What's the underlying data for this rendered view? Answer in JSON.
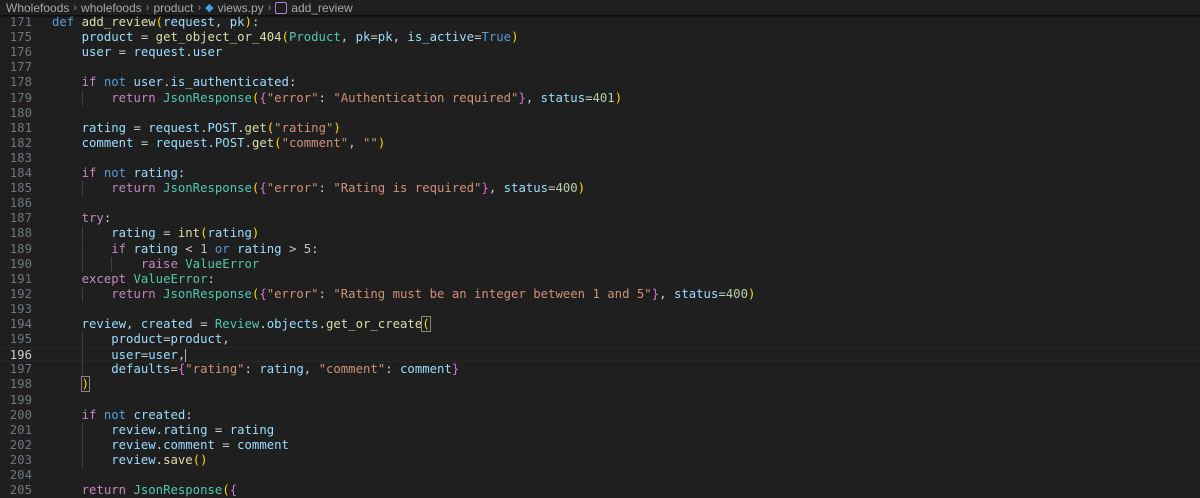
{
  "breadcrumb": {
    "items": [
      "Wholefoods",
      "wholefoods",
      "product",
      "views.py",
      "add_review"
    ]
  },
  "editor": {
    "language": "python",
    "active_line": 196,
    "lines": [
      {
        "num": "171",
        "text": "def add_review(request, pk):"
      },
      {
        "num": "175",
        "text": "    product = get_object_or_404(Product, pk=pk, is_active=True)"
      },
      {
        "num": "176",
        "text": "    user = request.user"
      },
      {
        "num": "177",
        "text": ""
      },
      {
        "num": "178",
        "text": "    if not user.is_authenticated:"
      },
      {
        "num": "179",
        "text": "        return JsonResponse({\"error\": \"Authentication required\"}, status=401)"
      },
      {
        "num": "180",
        "text": ""
      },
      {
        "num": "181",
        "text": "    rating = request.POST.get(\"rating\")"
      },
      {
        "num": "182",
        "text": "    comment = request.POST.get(\"comment\", \"\")"
      },
      {
        "num": "183",
        "text": ""
      },
      {
        "num": "184",
        "text": "    if not rating:"
      },
      {
        "num": "185",
        "text": "        return JsonResponse({\"error\": \"Rating is required\"}, status=400)"
      },
      {
        "num": "186",
        "text": ""
      },
      {
        "num": "187",
        "text": "    try:"
      },
      {
        "num": "188",
        "text": "        rating = int(rating)"
      },
      {
        "num": "189",
        "text": "        if rating < 1 or rating > 5:"
      },
      {
        "num": "190",
        "text": "            raise ValueError"
      },
      {
        "num": "191",
        "text": "    except ValueError:"
      },
      {
        "num": "192",
        "text": "        return JsonResponse({\"error\": \"Rating must be an integer between 1 and 5\"}, status=400)"
      },
      {
        "num": "193",
        "text": ""
      },
      {
        "num": "194",
        "text": "    review, created = Review.objects.get_or_create("
      },
      {
        "num": "195",
        "text": "        product=product,"
      },
      {
        "num": "196",
        "text": "        user=user,"
      },
      {
        "num": "197",
        "text": "        defaults={\"rating\": rating, \"comment\": comment}"
      },
      {
        "num": "198",
        "text": "    )"
      },
      {
        "num": "199",
        "text": ""
      },
      {
        "num": "200",
        "text": "    if not created:"
      },
      {
        "num": "201",
        "text": "        review.rating = rating"
      },
      {
        "num": "202",
        "text": "        review.comment = comment"
      },
      {
        "num": "203",
        "text": "        review.save()"
      },
      {
        "num": "204",
        "text": ""
      },
      {
        "num": "205",
        "text": "    return JsonResponse({"
      }
    ]
  },
  "colors": {
    "background": "#1f1f1f",
    "keyword": "#569cd6",
    "control_keyword": "#c586c0",
    "function": "#dcdcaa",
    "class": "#4ec9b0",
    "string": "#ce9178",
    "number": "#b5cea8",
    "variable": "#9cdcfe"
  }
}
